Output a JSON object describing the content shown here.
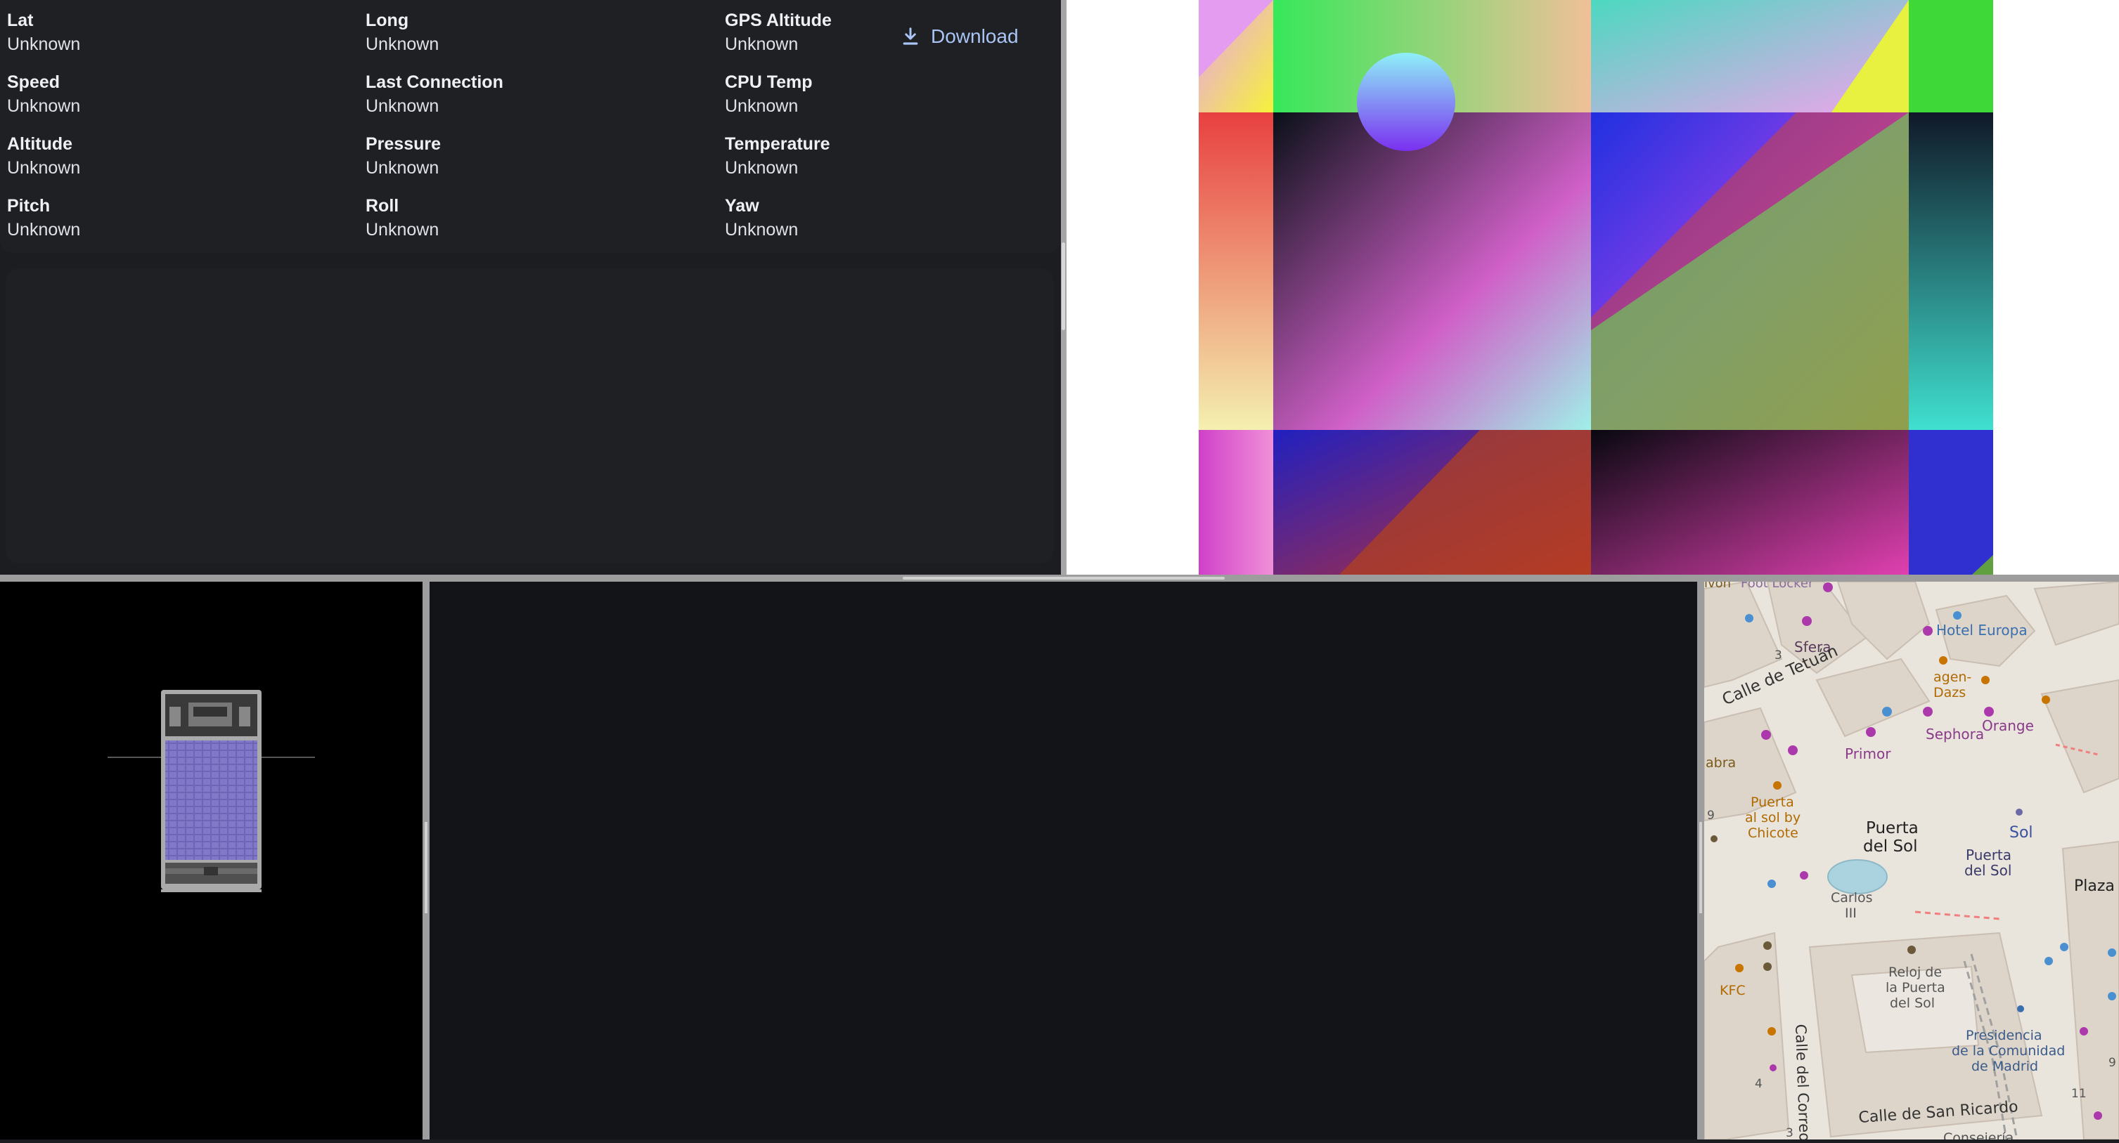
{
  "telemetry": {
    "fields": [
      {
        "label": "Lat",
        "value": "Unknown"
      },
      {
        "label": "Long",
        "value": "Unknown"
      },
      {
        "label": "GPS Altitude",
        "value": "Unknown"
      },
      {
        "label": "Speed",
        "value": "Unknown"
      },
      {
        "label": "Last Connection",
        "value": "Unknown"
      },
      {
        "label": "CPU Temp",
        "value": "Unknown"
      },
      {
        "label": "Altitude",
        "value": "Unknown"
      },
      {
        "label": "Pressure",
        "value": "Unknown"
      },
      {
        "label": "Temperature",
        "value": "Unknown"
      },
      {
        "label": "Pitch",
        "value": "Unknown"
      },
      {
        "label": "Roll",
        "value": "Unknown"
      },
      {
        "label": "Yaw",
        "value": "Unknown"
      }
    ],
    "download_label": "Download"
  },
  "map": {
    "labels": {
      "foot_locker": "Foot Locker",
      "hotel_europa": "Hotel Europa",
      "sfera": "Sfera",
      "calle_tetuan": "Calle de Tetuán",
      "haagen_dazs_1": "agen-",
      "haagen_dazs_2": "Dazs",
      "orange": "Orange",
      "sephora": "Sephora",
      "primor": "Primor",
      "abra": "abra",
      "ivon": "ivon",
      "puerta_sol_chicote_1": "Puerta",
      "puerta_sol_chicote_2": "al sol by",
      "puerta_sol_chicote_3": "Chicote",
      "puerta_del_sol_1": "Puerta",
      "puerta_del_sol_2": "del Sol",
      "sol": "Sol",
      "puerta_del_sol_small_1": "Puerta",
      "puerta_del_sol_small_2": "del Sol",
      "plaza": "Plaza",
      "carlos_1": "Carlos",
      "carlos_2": "III",
      "reloj_1": "Reloj de",
      "reloj_2": "la Puerta",
      "reloj_3": "del Sol",
      "kfc": "KFC",
      "presidencia_1": "Presidencia",
      "presidencia_2": "de la Comunidad",
      "presidencia_3": "de Madrid",
      "calle_correo": "Calle del Correo",
      "calle_san_ricardo": "Calle de San Ricardo",
      "conseje": "Consejería",
      "n3": "3",
      "n9": "9",
      "n4": "4",
      "n3b": "3",
      "n9b": "9",
      "n11": "11"
    }
  }
}
